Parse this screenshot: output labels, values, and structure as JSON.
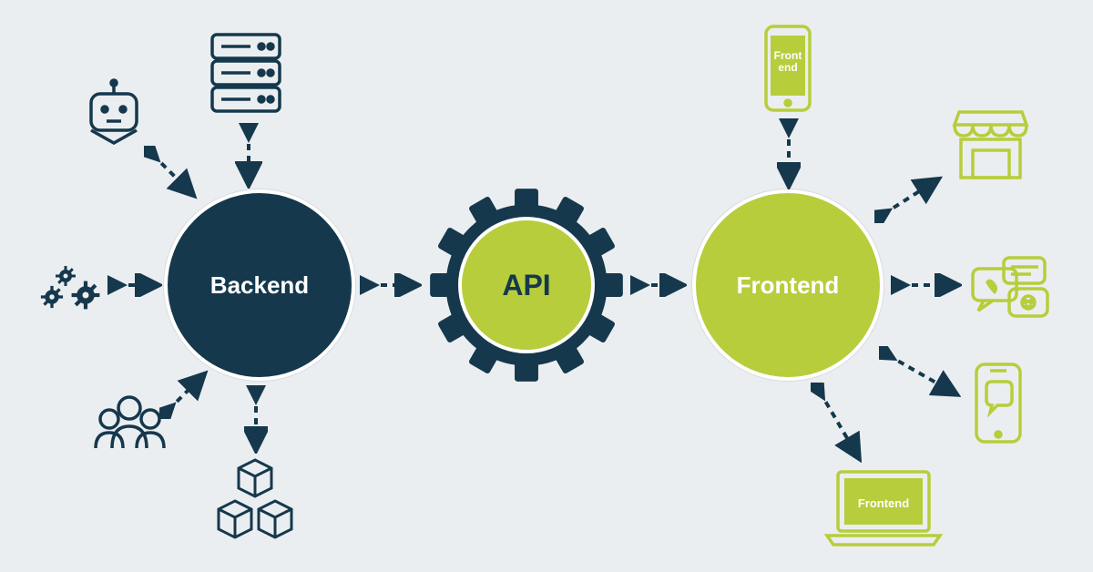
{
  "colors": {
    "dark": "#15384d",
    "green": "#b7cd3b",
    "bg": "#ebeef0",
    "white": "#ffffff"
  },
  "nodes": {
    "backend": {
      "label": "Backend"
    },
    "api": {
      "label": "API"
    },
    "frontend": {
      "label": "Frontend"
    }
  },
  "backend_icons": {
    "servers": "server-stack-icon",
    "robot": "robot-icon",
    "gears": "gears-icon",
    "users": "users-icon",
    "packages": "packages-icon"
  },
  "frontend_icons": {
    "phone": {
      "name": "phone-icon",
      "label": "Front\nend"
    },
    "shop": "storefront-icon",
    "chat_bubbles": "chat-bubbles-icon",
    "phone_chat": "phone-message-icon",
    "laptop": {
      "name": "laptop-icon",
      "label": "Frontend"
    }
  }
}
